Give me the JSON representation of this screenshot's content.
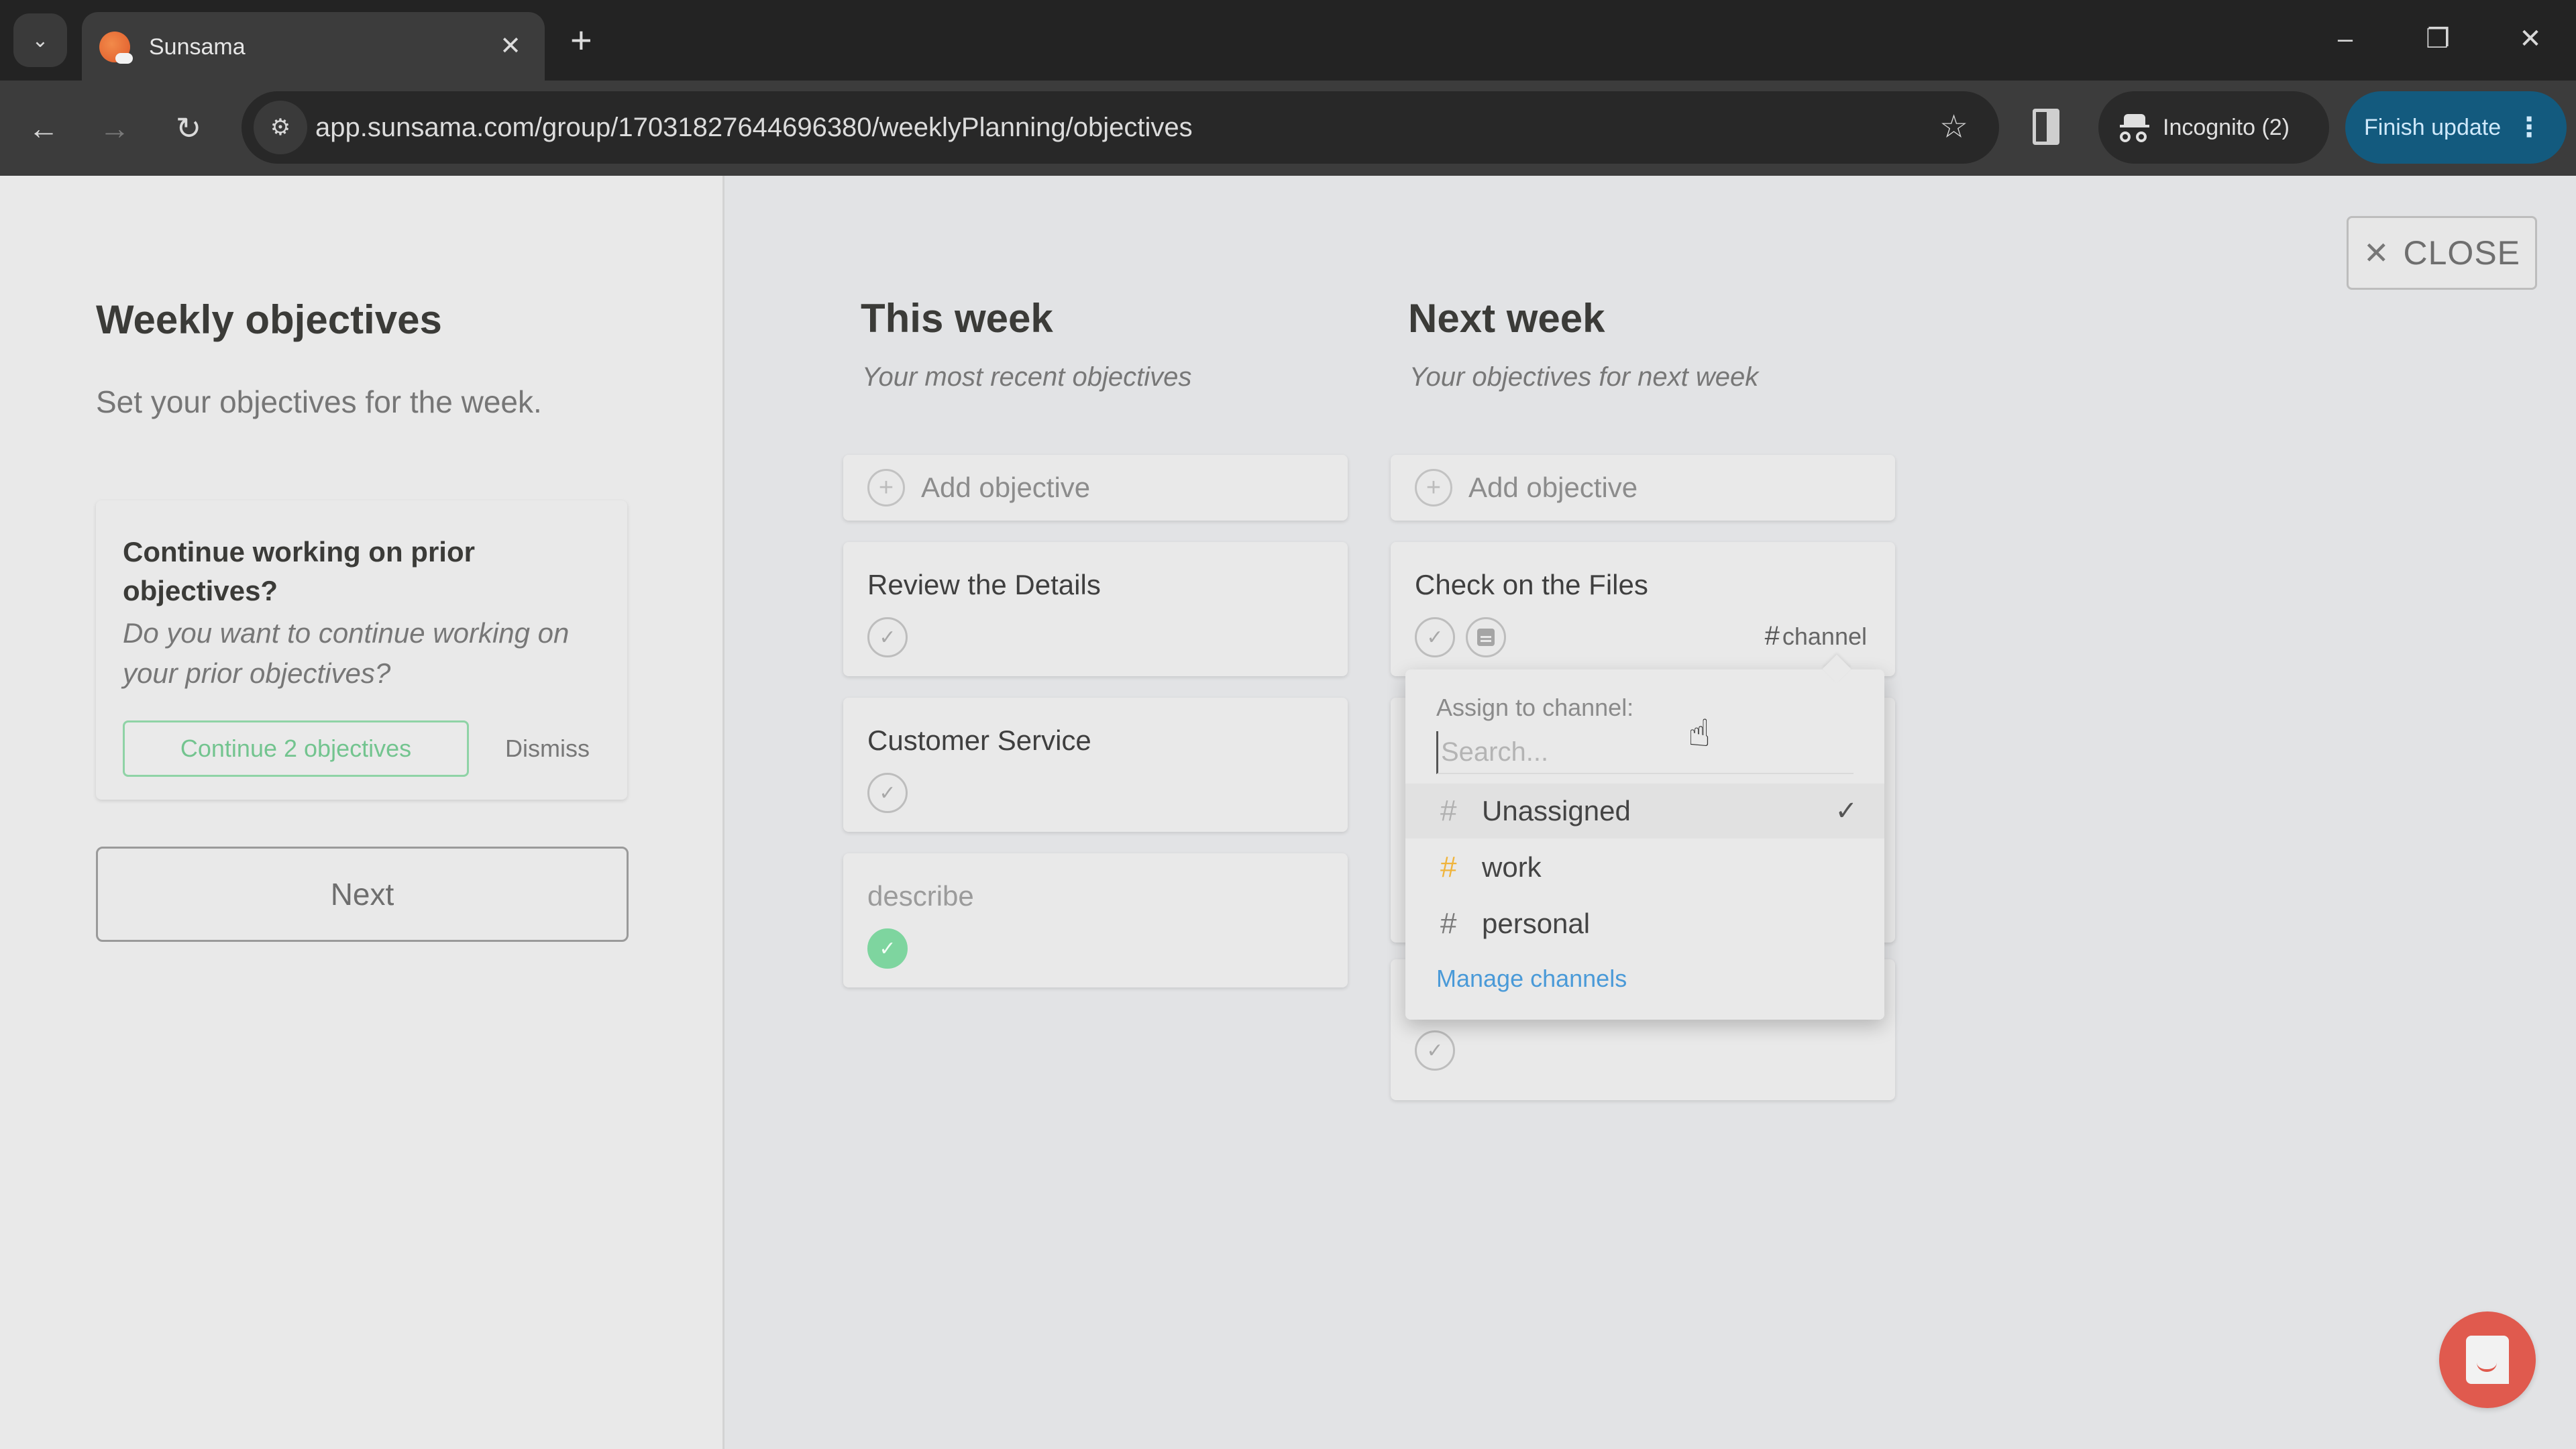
{
  "browser": {
    "tab_title": "Sunsama",
    "url": "app.sunsama.com/group/17031827644696380/weeklyPlanning/objectives",
    "incognito_label": "Incognito (2)",
    "finish_update_label": "Finish update",
    "icons": {
      "tab_menu": "⌄",
      "tab_close": "✕",
      "new_tab": "+",
      "back": "←",
      "forward": "→",
      "reload": "↻",
      "site_info": "⚙",
      "star": "☆",
      "minimize": "–",
      "restore": "❐",
      "close": "✕",
      "menu_dots": "⋮"
    }
  },
  "left_panel": {
    "title": "Weekly objectives",
    "subtitle": "Set your objectives for the week.",
    "prior_card": {
      "title": "Continue working on prior objectives?",
      "description": "Do you want to continue working on your prior objectives?",
      "continue_label": "Continue 2 objectives",
      "dismiss_label": "Dismiss"
    },
    "next_label": "Next"
  },
  "close_button": {
    "icon": "✕",
    "label": "CLOSE"
  },
  "columns": {
    "this_week": {
      "title": "This week",
      "subtitle": "Your most recent objectives",
      "add_label": "Add objective",
      "objectives": [
        {
          "title": "Review the Details",
          "completed": false
        },
        {
          "title": "Customer Service",
          "completed": false
        },
        {
          "title": "describe",
          "completed": true
        }
      ]
    },
    "next_week": {
      "title": "Next week",
      "subtitle": "Your objectives for next week",
      "add_label": "Add objective",
      "objectives": [
        {
          "title": "Check on the Files",
          "completed": false,
          "channel_label": "channel"
        }
      ]
    }
  },
  "channel_dropdown": {
    "label": "Assign to channel:",
    "search_placeholder": "Search...",
    "items": [
      {
        "hash": "#",
        "name": "Unassigned",
        "selected": true,
        "check": "✓",
        "color": "#b0b0b0"
      },
      {
        "hash": "#",
        "name": "work",
        "selected": false,
        "color": "#f0b43c"
      },
      {
        "hash": "#",
        "name": "personal",
        "selected": false,
        "color": "#7a7a7a"
      }
    ],
    "manage_label": "Manage channels"
  },
  "icons": {
    "check": "✓",
    "plus": "+",
    "hash": "#",
    "pointer": "☝"
  },
  "colors": {
    "accent_green": "#7ed59f",
    "link_blue": "#4a9ad8",
    "chat_red": "#e05a4e",
    "update_blue": "#135a7e"
  }
}
